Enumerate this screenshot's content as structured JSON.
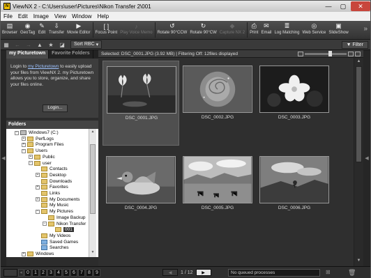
{
  "window": {
    "title": "ViewNX 2 - C:\\Users\\user\\Pictures\\Nikon Transfer 2\\001",
    "minimize": "—",
    "maximize": "▢",
    "close": "✕",
    "app_icon": "N"
  },
  "menu": [
    "File",
    "Edit",
    "Image",
    "View",
    "Window",
    "Help"
  ],
  "toolbar": [
    {
      "label": "Browser",
      "icon": "browser-icon",
      "glyph": "▤",
      "enabled": true
    },
    {
      "label": "GeoTag",
      "icon": "geotag-icon",
      "glyph": "◉",
      "enabled": true
    },
    {
      "label": "Edit",
      "icon": "edit-icon",
      "glyph": "✎",
      "enabled": true
    },
    {
      "label": "Transfer",
      "icon": "transfer-icon",
      "glyph": "⇩",
      "enabled": true
    },
    {
      "label": "Movie Editor",
      "icon": "movie-editor-icon",
      "glyph": "▶",
      "enabled": true
    },
    {
      "label": "Focus Point",
      "icon": "focus-point-icon",
      "glyph": "[ ]",
      "enabled": true
    },
    {
      "label": "Play Voice Memo",
      "icon": "voice-memo-icon",
      "glyph": "♪",
      "enabled": false
    },
    {
      "label": "Rotate 90°CCW",
      "icon": "rotate-ccw-icon",
      "glyph": "↺",
      "enabled": true
    },
    {
      "label": "Rotate 90°CW",
      "icon": "rotate-cw-icon",
      "glyph": "↻",
      "enabled": true
    },
    {
      "label": "Capture NX 2",
      "icon": "capture-nx-icon",
      "glyph": "◆",
      "enabled": false
    },
    {
      "label": "Print",
      "icon": "print-icon",
      "glyph": "⎙",
      "enabled": true
    },
    {
      "label": "Email",
      "icon": "email-icon",
      "glyph": "✉",
      "enabled": true
    },
    {
      "label": "Log Matching",
      "icon": "log-matching-icon",
      "glyph": "≣",
      "enabled": true
    },
    {
      "label": "Web Service",
      "icon": "web-service-icon",
      "glyph": "◎",
      "enabled": true
    },
    {
      "label": "SlideShow",
      "icon": "slideshow-icon",
      "glyph": "▣",
      "enabled": true
    }
  ],
  "toolbar_more": "»",
  "subtoolbar": {
    "sort_label": "Sort",
    "sort_value": "RBC",
    "sort_arrow": "▾",
    "filter_label": "▼ Filter"
  },
  "left_panel": {
    "tabs": [
      "my Picturetown",
      "Favorite Folders"
    ],
    "picturetown": {
      "text_before": "Login to ",
      "link": "my Picturetown",
      "text_after": " to easily upload your files from ViewNX 2. my Picturetown allows you to store, organize, and share your files online.",
      "login_button": "Login..."
    },
    "folders_header": "Folders",
    "tree": [
      {
        "label": "Windows7 (C:)",
        "level": 0,
        "toggle": "−",
        "type": "drive"
      },
      {
        "label": "PerfLogs",
        "level": 1,
        "toggle": "+",
        "type": "folder"
      },
      {
        "label": "Program Files",
        "level": 1,
        "toggle": "+",
        "type": "folder"
      },
      {
        "label": "Users",
        "level": 1,
        "toggle": "−",
        "type": "folder"
      },
      {
        "label": "Public",
        "level": 2,
        "toggle": "+",
        "type": "folder"
      },
      {
        "label": "user",
        "level": 2,
        "toggle": "−",
        "type": "folder"
      },
      {
        "label": "Contacts",
        "level": 3,
        "toggle": "",
        "type": "folder"
      },
      {
        "label": "Desktop",
        "level": 3,
        "toggle": "+",
        "type": "folder"
      },
      {
        "label": "Downloads",
        "level": 3,
        "toggle": "",
        "type": "folder"
      },
      {
        "label": "Favorites",
        "level": 3,
        "toggle": "+",
        "type": "folder"
      },
      {
        "label": "Links",
        "level": 3,
        "toggle": "",
        "type": "folder"
      },
      {
        "label": "My Documents",
        "level": 3,
        "toggle": "+",
        "type": "folder"
      },
      {
        "label": "My Music",
        "level": 3,
        "toggle": "",
        "type": "folder"
      },
      {
        "label": "My Pictures",
        "level": 3,
        "toggle": "−",
        "type": "folder"
      },
      {
        "label": "Image Backup",
        "level": 4,
        "toggle": "",
        "type": "folder"
      },
      {
        "label": "Nikon Transfer",
        "level": 4,
        "toggle": "−",
        "type": "folder"
      },
      {
        "label": "001",
        "level": 5,
        "toggle": "",
        "type": "folder",
        "selected": true
      },
      {
        "label": "My Videos",
        "level": 3,
        "toggle": "",
        "type": "folder"
      },
      {
        "label": "Saved Games",
        "level": 3,
        "toggle": "",
        "type": "special"
      },
      {
        "label": "Searches",
        "level": 3,
        "toggle": "",
        "type": "special"
      },
      {
        "label": "Windows",
        "level": 1,
        "toggle": "+",
        "type": "folder"
      }
    ]
  },
  "status": "Selected: DSC_0001.JPG (3.92 MB) | Filtering Off: 12files displayed",
  "thumbnails": [
    {
      "name": "DSC_0001.JPG",
      "selected": true,
      "subject": "lotus-flowers"
    },
    {
      "name": "DSC_0002.JPG",
      "selected": false,
      "subject": "rose"
    },
    {
      "name": "DSC_0003.JPG",
      "selected": false,
      "subject": "white-flower"
    },
    {
      "name": "DSC_0004.JPG",
      "selected": false,
      "subject": "mandarin-duck"
    },
    {
      "name": "DSC_0005.JPG",
      "selected": false,
      "subject": "horses-field"
    },
    {
      "name": "DSC_0006.JPG",
      "selected": false,
      "subject": "landscape"
    }
  ],
  "bottom": {
    "color_labels": [
      "0",
      "1",
      "2",
      "3",
      "4",
      "5",
      "6",
      "7",
      "8",
      "9"
    ],
    "pager": {
      "prev": "◀",
      "page": "1 / 12",
      "next": "▶"
    },
    "queue": "No queued processes"
  }
}
